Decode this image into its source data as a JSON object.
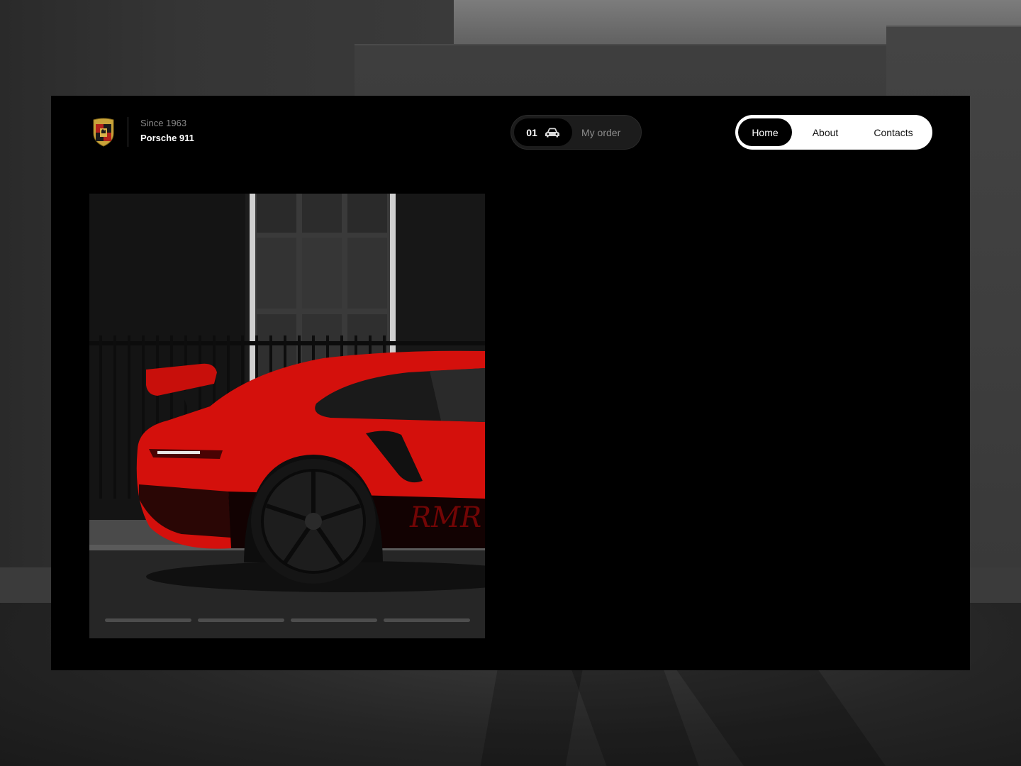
{
  "brand": {
    "since": "Since 1963",
    "model": "Porsche 911",
    "crest_icon": "porsche-crest-icon"
  },
  "order": {
    "count": "01",
    "icon": "car-icon",
    "label": "My order"
  },
  "nav": {
    "items": [
      {
        "label": "Home",
        "active": true
      },
      {
        "label": "About",
        "active": false
      },
      {
        "label": "Contacts",
        "active": false
      }
    ]
  },
  "hero": {
    "slides_total": 4,
    "slide_progress": [
      0,
      0,
      0,
      0
    ]
  },
  "colors": {
    "panel": "#000000",
    "accent_red": "#d4100c",
    "nav_bg": "#ffffff"
  }
}
